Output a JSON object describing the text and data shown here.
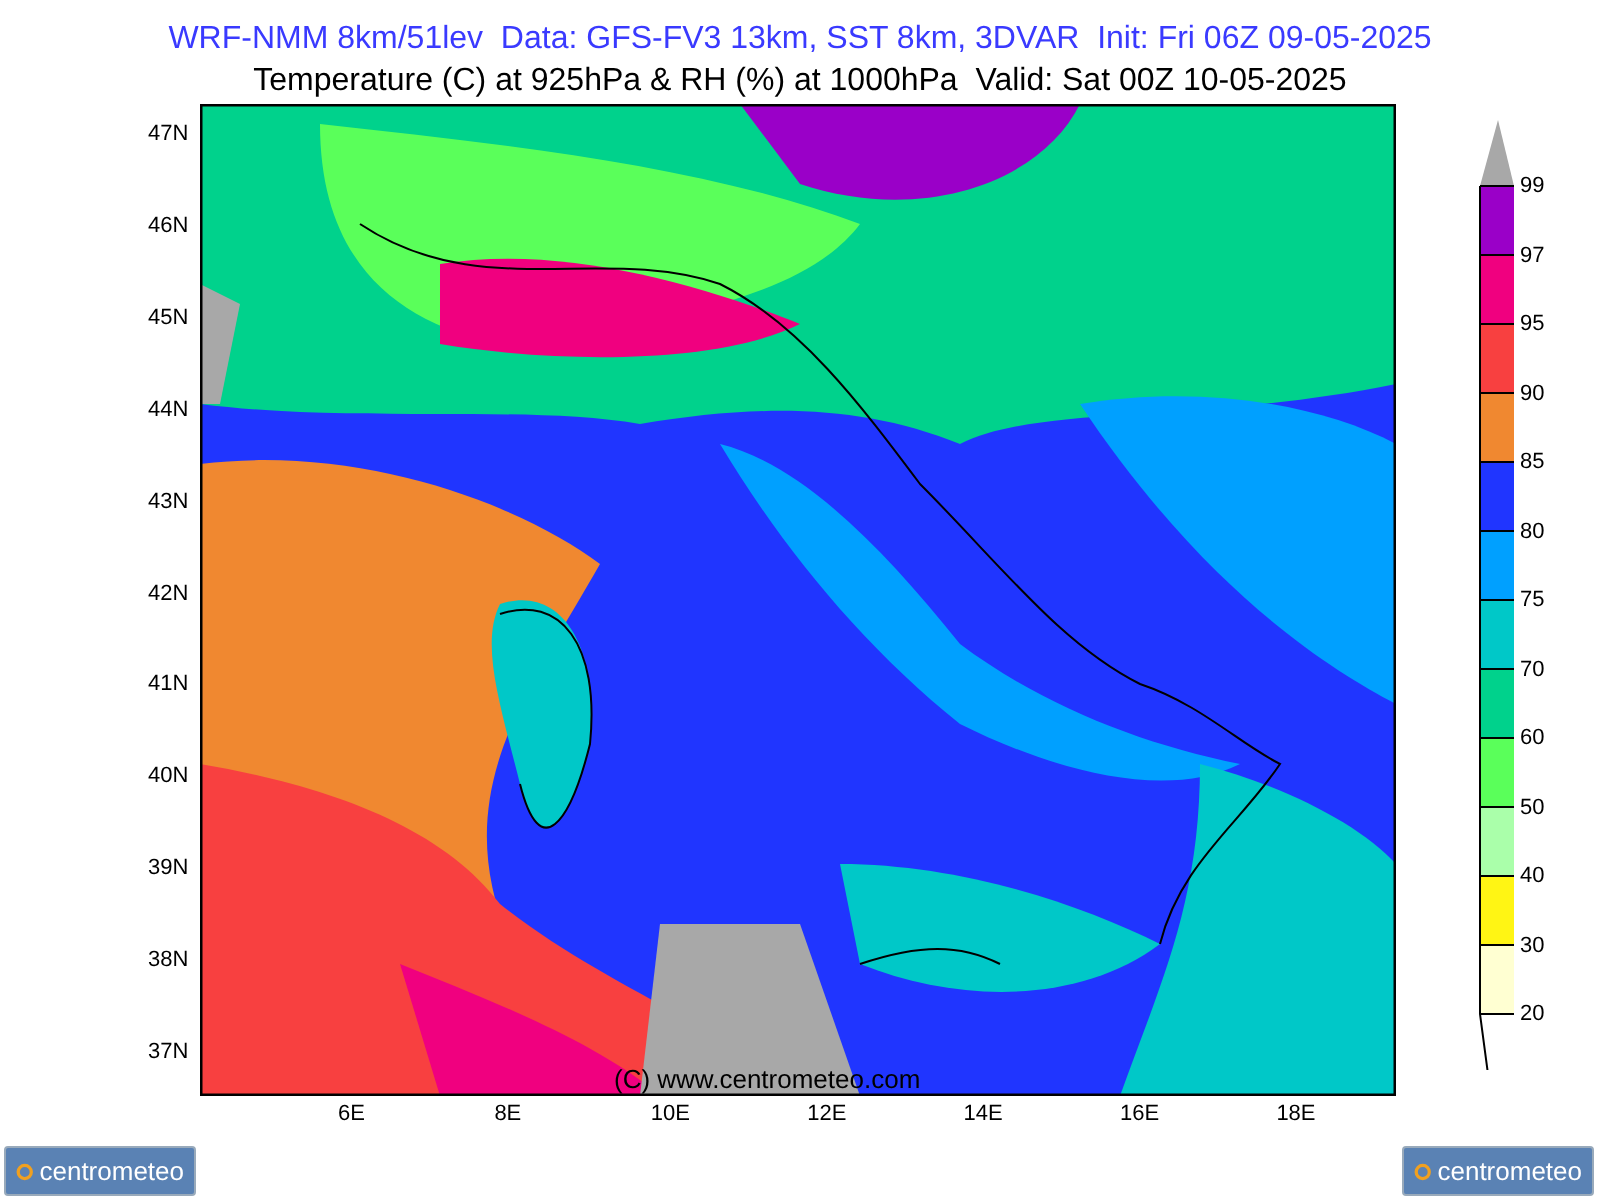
{
  "header": {
    "line_1": "WRF-NMM 8km/51lev  Data: GFS-FV3 13km, SST 8km, 3DVAR  Init: Fri 06Z 09-05-2025",
    "line_2": "Temperature (C) at 925hPa & RH (%) at 1000hPa  Valid: Sat 00Z 10-05-2025"
  },
  "map": {
    "copyright": "(C) www.centrometeo.com",
    "lat_labels": [
      "47N",
      "46N",
      "45N",
      "44N",
      "43N",
      "42N",
      "41N",
      "40N",
      "39N",
      "38N",
      "37N"
    ],
    "lon_labels": [
      "6E",
      "8E",
      "10E",
      "12E",
      "14E",
      "16E",
      "18E"
    ]
  },
  "legend": {
    "labels": [
      "99",
      "97",
      "95",
      "90",
      "85",
      "80",
      "75",
      "70",
      "60",
      "50",
      "40",
      "30",
      "20"
    ],
    "bands": [
      {
        "color": "#9a00c8"
      },
      {
        "color": "#f0007f"
      },
      {
        "color": "#f84040"
      },
      {
        "color": "#f08830"
      },
      {
        "color": "#2035ff"
      },
      {
        "color": "#00a0ff"
      },
      {
        "color": "#00c8c8"
      },
      {
        "color": "#00d28c"
      },
      {
        "color": "#5aff5a"
      },
      {
        "color": "#aaffaa"
      },
      {
        "color": "#fff514"
      },
      {
        "color": "#ffffd2"
      }
    ]
  },
  "logos": [
    "centrometeo",
    "centrometeo"
  ]
}
